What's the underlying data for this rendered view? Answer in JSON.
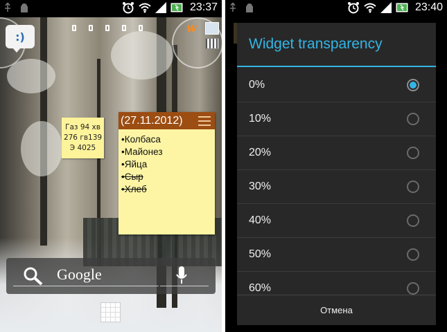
{
  "left": {
    "status_time": "23:37",
    "sticky_small": {
      "lines": [
        "Газ 94 хв",
        "276 гв139",
        "Э 4025"
      ]
    },
    "note": {
      "date": "(27.11.2012)",
      "items": [
        {
          "text": "•Колбаса",
          "done": false
        },
        {
          "text": "•Майонез",
          "done": false
        },
        {
          "text": "•Яйца",
          "done": false
        },
        {
          "text": "•Сыр",
          "done": true
        },
        {
          "text": "•Хлеб",
          "done": true
        }
      ]
    },
    "search": {
      "label": "Google"
    },
    "walkman_label": "W"
  },
  "right": {
    "status_time": "23:40",
    "dialog": {
      "title": "Widget transparency",
      "options": [
        {
          "label": "0%",
          "checked": true
        },
        {
          "label": "10%",
          "checked": false
        },
        {
          "label": "20%",
          "checked": false
        },
        {
          "label": "30%",
          "checked": false
        },
        {
          "label": "40%",
          "checked": false
        },
        {
          "label": "50%",
          "checked": false
        },
        {
          "label": "60%",
          "checked": false
        }
      ],
      "cancel": "Отмена"
    }
  },
  "colors": {
    "accent": "#33b5e5",
    "note_header": "#9c4d12",
    "note_bg": "#fdf5a4"
  }
}
